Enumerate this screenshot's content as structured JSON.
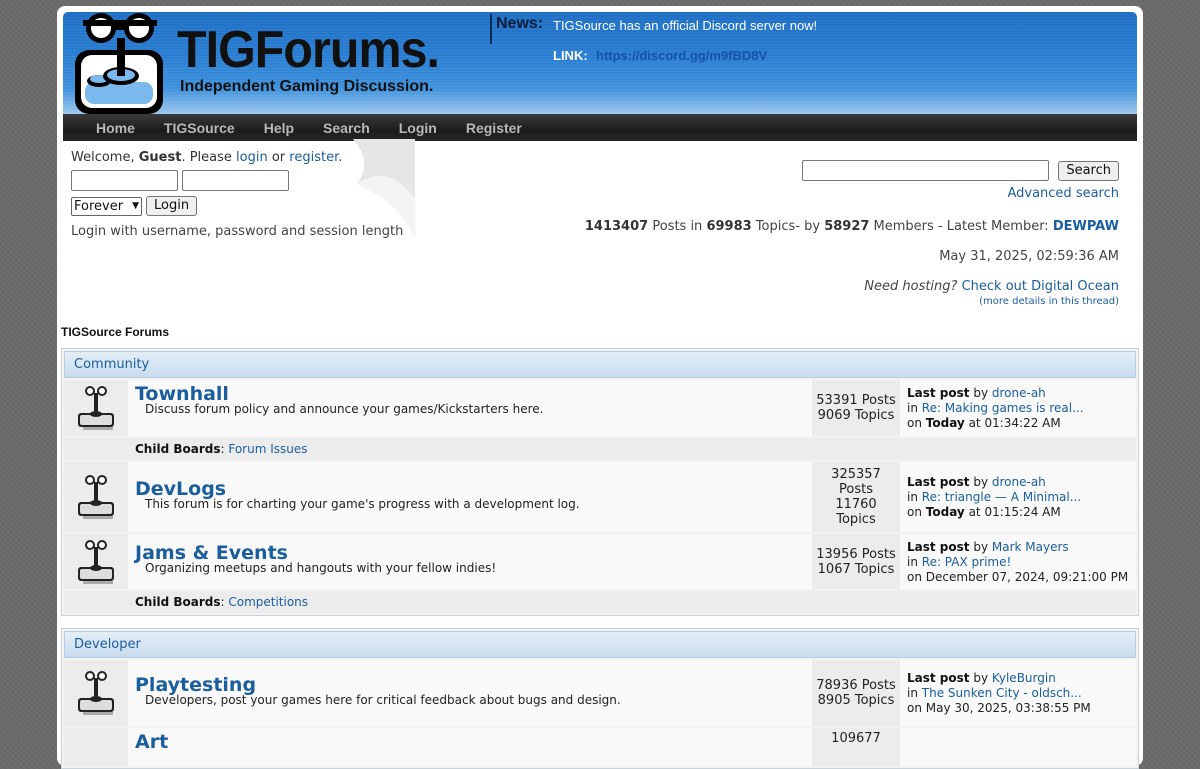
{
  "header": {
    "logo_title": "TIGForums.",
    "logo_subtitle": "Independent Gaming Discussion.",
    "news_label": "News:",
    "news_text": "TIGSource has an official Discord server now!",
    "news_link_label": "LINK:",
    "news_link": "https://discord.gg/m9fBD8V"
  },
  "nav": [
    "Home",
    "TIGSource",
    "Help",
    "Search",
    "Login",
    "Register"
  ],
  "user": {
    "welcome_prefix": "Welcome, ",
    "guest": "Guest",
    "please": ". Please ",
    "login": "login",
    "or": " or ",
    "register": "register",
    "period": ".",
    "session_value": "Forever",
    "login_button": "Login",
    "hint": "Login with username, password and session length"
  },
  "search": {
    "button": "Search",
    "advanced": "Advanced search"
  },
  "stats": {
    "posts": "1413407",
    "posts_label": " Posts in ",
    "topics": "69983",
    "topics_label": " Topics- by ",
    "members": "58927",
    "members_label": " Members - Latest Member: ",
    "latest_member": "DEWPAW",
    "date": "May 31, 2025, 02:59:36 AM",
    "hosting_prefix": "Need hosting?",
    "hosting_link": "Check out Digital Ocean",
    "details": "(more details in this thread)"
  },
  "section_title": "TIGSource Forums",
  "categories": [
    {
      "name": "Community",
      "boards": [
        {
          "name": "Townhall",
          "desc": "Discuss forum policy and announce your games/Kickstarters here.",
          "posts": "53391 Posts",
          "topics": "9069 Topics",
          "last_by": "drone-ah",
          "last_in": "Re: Making games is real...",
          "last_on_bold": "Today",
          "last_on": " at 01:34:22 AM",
          "child_label": "Child Boards",
          "child": "Forum Issues"
        },
        {
          "name": "DevLogs",
          "desc": "This forum is for charting your game's progress with a development log.",
          "posts_num": "325357",
          "posts_word": "Posts",
          "topics_num": "11760",
          "topics_word": "Topics",
          "last_by": "drone-ah",
          "last_in": "Re: triangle — A Minimal...",
          "last_on_bold": "Today",
          "last_on": " at 01:15:24 AM"
        },
        {
          "name": "Jams & Events",
          "desc": "Organizing meetups and hangouts with your fellow indies!",
          "posts": "13956 Posts",
          "topics": "1067 Topics",
          "last_by": "Mark Mayers",
          "last_in": "Re: PAX prime!",
          "last_on": "on December 07, 2024, 09:21:00 PM",
          "child_label": "Child Boards",
          "child": "Competitions"
        }
      ]
    },
    {
      "name": "Developer",
      "boards": [
        {
          "name": "Playtesting",
          "desc": "Developers, post your games here for critical feedback about bugs and design.",
          "posts": "78936 Posts",
          "topics": "8905 Topics",
          "last_by": "KyleBurgin",
          "last_in": "The Sunken City - oldsch...",
          "last_on": "on May 30, 2025, 03:38:55 PM"
        },
        {
          "name": "Art",
          "posts_num": "109677"
        }
      ]
    }
  ],
  "labels": {
    "last_post": "Last post",
    "by": " by ",
    "in": "in ",
    "on": "on "
  },
  "colors": {
    "link": "#1a5e9e",
    "header_blue": "#2b7fd2",
    "nav_dark": "#1c1c1c"
  }
}
